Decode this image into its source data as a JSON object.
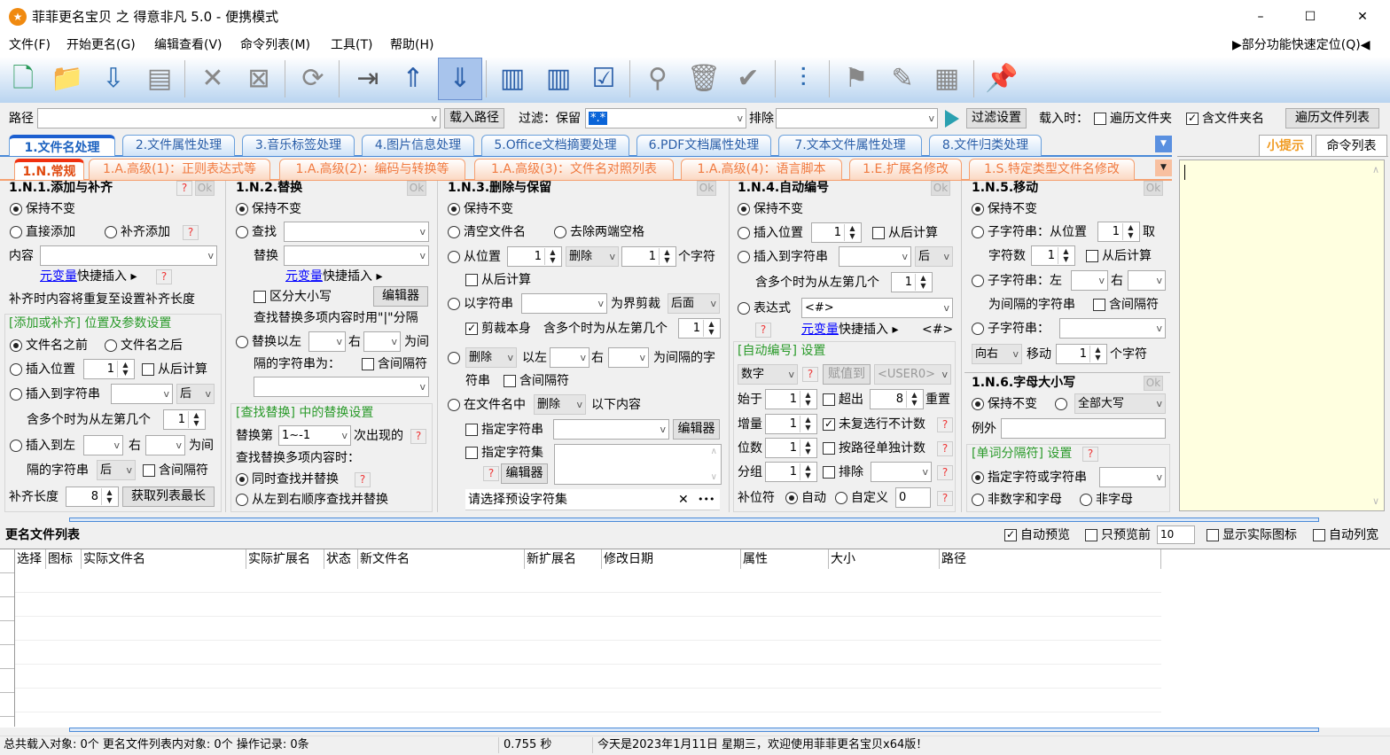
{
  "window": {
    "title": "菲菲更名宝贝 之 得意非凡 5.0 - 便携模式",
    "minimize": "–",
    "maximize": "☐",
    "close": "✕"
  },
  "menu": {
    "items": [
      "文件(F)",
      "开始更名(G)",
      "编辑查看(V)",
      "命令列表(M)",
      "工具(T)",
      "帮助(H)"
    ],
    "quick_locate": "▶部分功能快速定位(Q)◀"
  },
  "toolbar": {
    "icons": [
      "new-file",
      "add-folder",
      "import-list",
      "export-list",
      "remove",
      "clear",
      "refresh",
      "move-right",
      "move-up",
      "move-down",
      "column-left",
      "columns",
      "checklist",
      "search",
      "trash",
      "check-circle",
      "sliders",
      "flag",
      "edit-table",
      "grid-table",
      "pin"
    ]
  },
  "pathbar": {
    "path_label": "路径",
    "path_value": "",
    "load_path": "载入路径",
    "filter_label": "过滤：保留",
    "filter_value": "*.*",
    "exclude_label": "排除",
    "exclude_value": "",
    "filter_settings": "过滤设置",
    "load_when": "载入时：",
    "traverse_folders": "遍历文件夹",
    "include_folder_name": "含文件夹名",
    "traverse_list": "遍历文件列表"
  },
  "tabs_main": [
    "1.文件名处理",
    "2.文件属性处理",
    "3.音乐标签处理",
    "4.图片信息处理",
    "5.Office文档摘要处理",
    "6.PDF文档属性处理",
    "7.文本文件属性处理",
    "8.文件归类处理"
  ],
  "tabs_sub": [
    "1.N.常规",
    "1.A.高级(1)：正则表达式等",
    "1.A.高级(2)：编码与转换等",
    "1.A.高级(3)：文件名对照列表",
    "1.A.高级(4)：语言脚本",
    "1.E.扩展名修改",
    "1.S.特定类型文件名修改"
  ],
  "side_tabs": [
    "小提示",
    "命令列表"
  ],
  "common": {
    "q": "?",
    "ok": "Ok",
    "keep": "保持不变",
    "var_link": "元变量",
    "quick_insert": "快捷插入 ▸",
    "editor": "编辑器",
    "after": "后",
    "right": "右",
    "between": "为间",
    "sep_str": "隔的字符串",
    "incl_sep": "含间隔符",
    "from_back": "从后计算",
    "nth": "含多个时为从左第几个",
    "one": "1",
    "delete": "删除"
  },
  "p1": {
    "title": "1.N.1.添加与补齐",
    "direct_add": "直接添加",
    "pad_add": "补齐添加",
    "content": "内容",
    "pad_note": "补齐时内容将重复至设置补齐长度",
    "group": "[添加或补齐] 位置及参数设置",
    "before_name": "文件名之前",
    "after_name": "文件名之后",
    "insert_pos": "插入位置",
    "insert_str": "插入到字符串",
    "insert_left": "插入到左",
    "pad_len": "补齐长度",
    "pad_len_value": "8",
    "get_longest": "获取列表最长"
  },
  "p2": {
    "title": "1.N.2.替换",
    "find": "查找",
    "replace": "替换",
    "case": "区分大小写",
    "multi_note": "查找替换多项内容时用\"|\"分隔",
    "replace_left": "替换以左",
    "sep_str_is": "隔的字符串为：",
    "group": "[查找替换] 中的替换设置",
    "replace_nth": "替换第",
    "nth_value": "1~-1",
    "occurrence": "次出现的",
    "multi_when": "查找替换多项内容时：",
    "simultaneous": "同时查找并替换",
    "sequential": "从左到右顺序查找并替换"
  },
  "p3": {
    "title": "1.N.3.删除与保留",
    "clear_name": "清空文件名",
    "trim": "去除两端空格",
    "from_pos": "从位置",
    "chars": "个字符",
    "by_string": "以字符串",
    "cut_by": "为界剪裁",
    "after_side": "后面",
    "cut_self": "剪裁本身",
    "left": "以左",
    "between_str": "为间隔的字",
    "str_tail": "符串",
    "in_name": "在文件名中",
    "below": "以下内容",
    "spec_str": "指定字符串",
    "spec_set": "指定字符集",
    "preset_placeholder": "请选择预设字符集",
    "clear_x": "✕",
    "more": "•••"
  },
  "p4": {
    "title": "1.N.4.自动编号",
    "insert_pos": "插入位置",
    "insert_str": "插入到字符串",
    "expr": "表达式",
    "expr_value": "<#>",
    "expr_hint": "<#>",
    "group": "[自动编号] 设置",
    "type": "数字",
    "assign_to": "赋值到",
    "user_var": "<USER0>",
    "start": "始于",
    "exceed": "超出",
    "exceed_value": "8",
    "reset": "重置",
    "increment": "增量",
    "skip_unchecked": "未复选行不计数",
    "digits": "位数",
    "per_path": "按路径单独计数",
    "group_size": "分组",
    "exclude": "排除",
    "pad_char": "补位符",
    "auto": "自动",
    "custom": "自定义",
    "custom_value": "0"
  },
  "p5": {
    "title": "1.N.5.移动",
    "sub_from": "子字符串：从位置",
    "take": "取",
    "char_count": "字符数",
    "sub_left": "子字符串：左",
    "between_str": "为间隔的字符串",
    "sub": "子字符串：",
    "direction": "向右",
    "move": "移动",
    "chars": "个字符"
  },
  "p6": {
    "title": "1.N.6.字母大小写",
    "all_upper": "全部大写",
    "exception": "例外",
    "group": "[单词分隔符] 设置",
    "spec": "指定字符或字符串",
    "non_alnum": "非数字和字母",
    "non_alpha": "非字母"
  },
  "filelist": {
    "title": "更名文件列表",
    "auto_preview": "自动预览",
    "preview_first": "只预览前",
    "preview_count": "10",
    "show_icons": "显示实际图标",
    "auto_width": "自动列宽",
    "columns": [
      "选择",
      "图标",
      "实际文件名",
      "实际扩展名",
      "状态",
      "新文件名",
      "新扩展名",
      "修改日期",
      "属性",
      "大小",
      "路径"
    ]
  },
  "status": {
    "counts": "总共载入对象: 0个  更名文件列表内对象: 0个  操作记录: 0条",
    "time": "0.755 秒",
    "message": "今天是2023年1月11日 星期三，欢迎使用菲菲更名宝贝x64版！"
  }
}
